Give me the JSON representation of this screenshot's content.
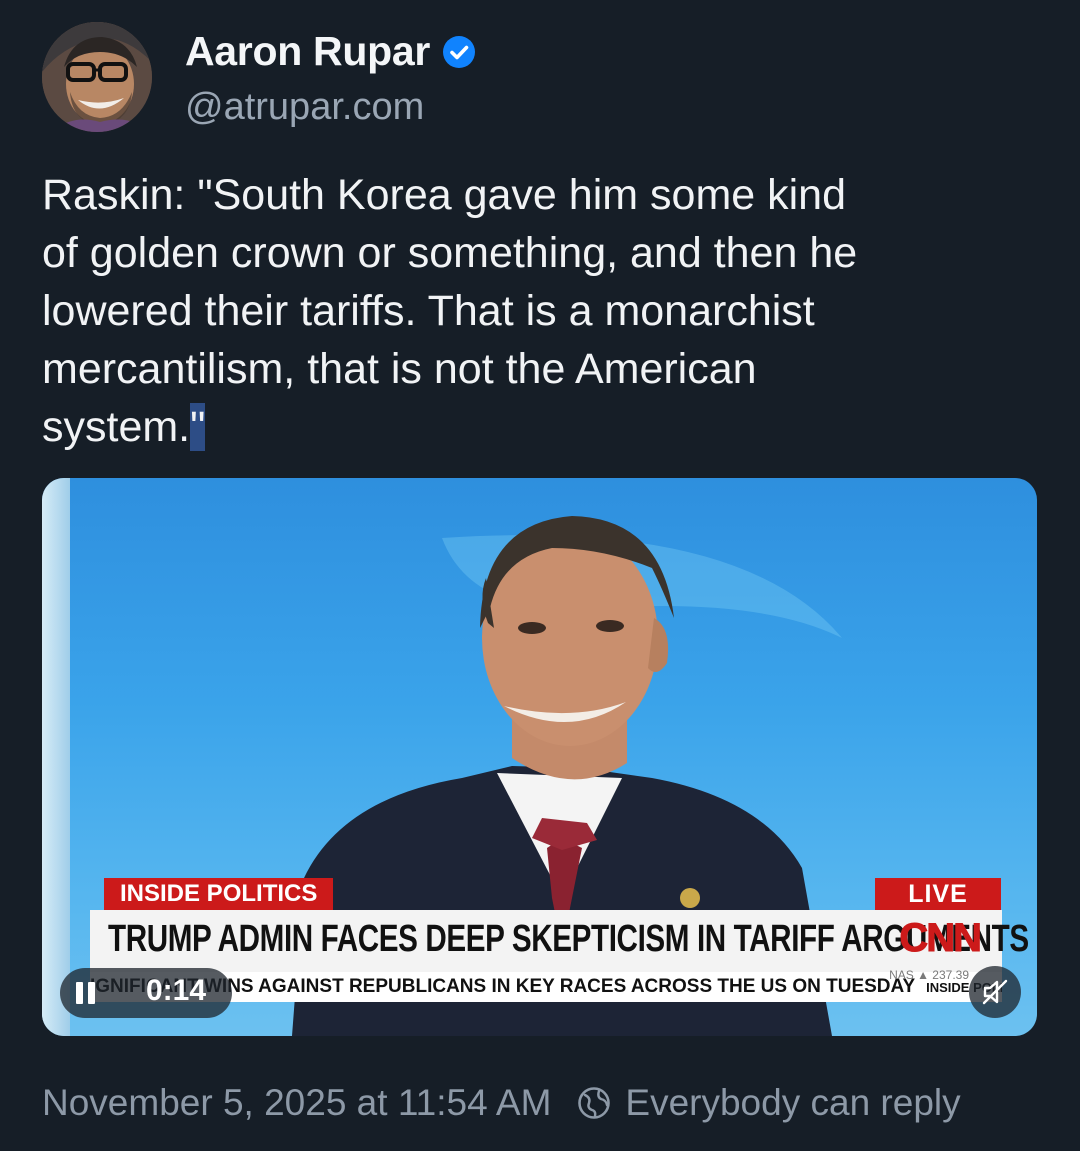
{
  "author": {
    "display_name": "Aaron Rupar",
    "handle": "@atrupar.com",
    "verified": true
  },
  "post": {
    "text_main": "Raskin: \"South Korea gave him some kind\nof golden crown or something, and then he\nlowered their tariffs. That is a monarchist\nmercantilism, that is not the American\nsystem.",
    "text_selected": "\""
  },
  "video": {
    "banner_label": "INSIDE POLITICS",
    "live_label": "LIVE",
    "chyron": "TRUMP ADMIN FACES DEEP SKEPTICISM IN TARIFF ARGUMENTS",
    "network_logo": "CNN",
    "ticker": "IGNIFICANT WINS AGAINST REPUBLICANS IN KEY RACES ACROSS THE US ON TUESDAY",
    "ticker_tag": "INSIDE POLITICS",
    "market_ticker": "NAS ▲ 237.39",
    "time": "0:14",
    "playing": true,
    "muted": true
  },
  "footer": {
    "timestamp": "November 5, 2025 at 11:54 AM",
    "reply_setting": "Everybody can reply"
  },
  "colors": {
    "background": "#161e27",
    "verified_blue": "#1083fe",
    "selection": "#2d4d86",
    "cnn_red": "#cc1a1a"
  }
}
